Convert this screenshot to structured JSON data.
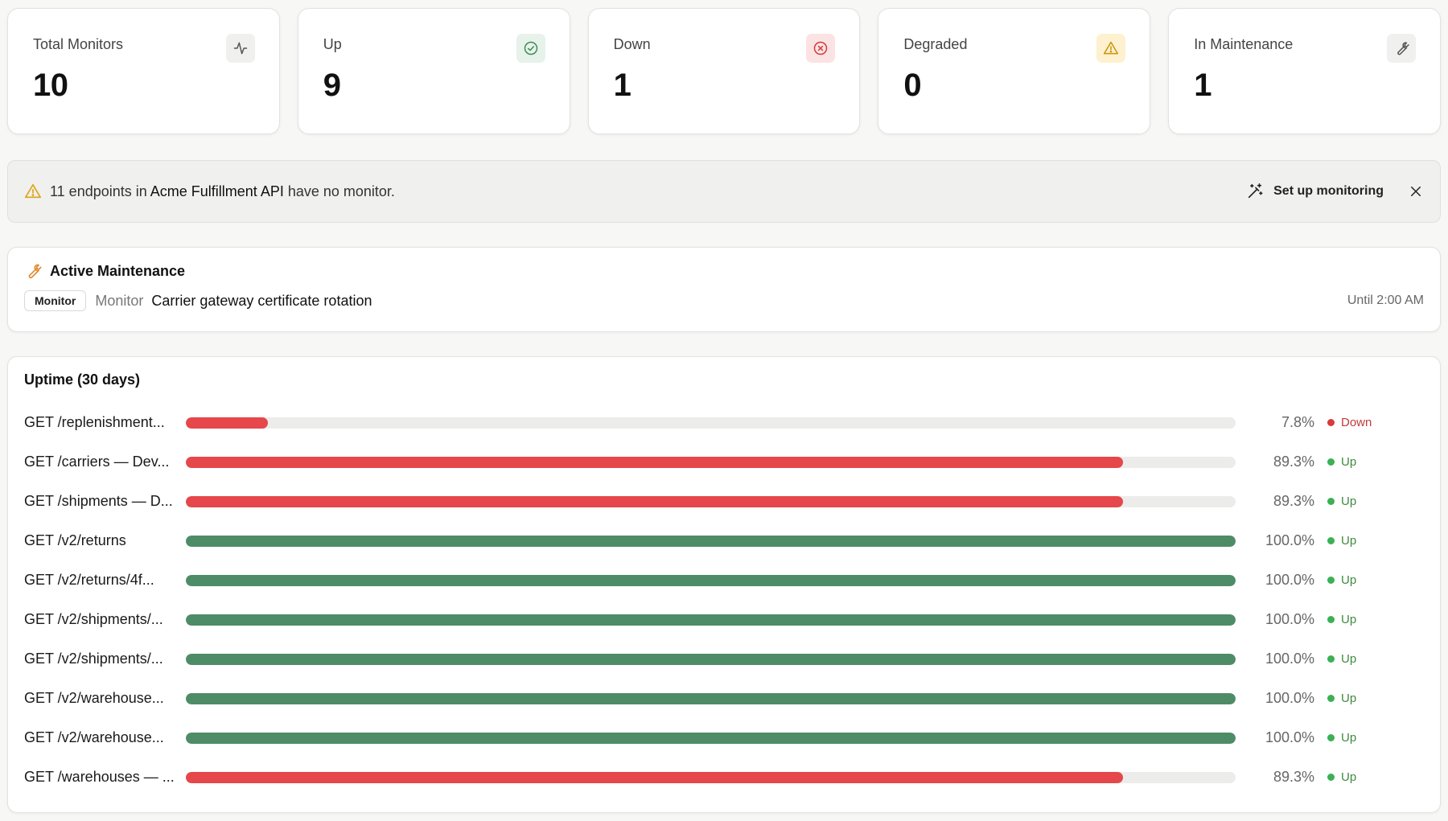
{
  "stats": [
    {
      "label": "Total Monitors",
      "value": "10",
      "icon": "activity-icon",
      "icon_bg": "#f0f0ef",
      "icon_color": "#555555"
    },
    {
      "label": "Up",
      "value": "9",
      "icon": "check-circle-icon",
      "icon_bg": "#e6f2ea",
      "icon_color": "#3f8a5c"
    },
    {
      "label": "Down",
      "value": "1",
      "icon": "x-circle-icon",
      "icon_bg": "#fbe3e3",
      "icon_color": "#d33b3b"
    },
    {
      "label": "Degraded",
      "value": "0",
      "icon": "warning-icon",
      "icon_bg": "#fdf1cf",
      "icon_color": "#c9940a"
    },
    {
      "label": "In Maintenance",
      "value": "1",
      "icon": "wrench-icon",
      "icon_bg": "#f0f0ef",
      "icon_color": "#555555"
    }
  ],
  "banner": {
    "count_text": "11 endpoints in ",
    "api_name": "Acme Fulfillment API",
    "suffix": " have no monitor.",
    "setup_label": "Set up monitoring"
  },
  "maintenance": {
    "heading": "Active Maintenance",
    "chip": "Monitor",
    "type": "Monitor",
    "title": "Carrier gateway certificate rotation",
    "until": "Until 2:00 AM"
  },
  "uptime": {
    "title": "Uptime (30 days)",
    "colors": {
      "red": "#e5474b",
      "green": "#4e8c68",
      "up_text": "#3f8a3f",
      "down_text": "#c33a3a",
      "up_dot": "#3cb054",
      "down_dot": "#d93a3a"
    },
    "rows": [
      {
        "label": "GET /replenishment...",
        "pct": "7.8%",
        "value": 7.8,
        "bar": "red",
        "status": "Down"
      },
      {
        "label": "GET /carriers — Dev...",
        "pct": "89.3%",
        "value": 89.3,
        "bar": "red",
        "status": "Up"
      },
      {
        "label": "GET /shipments — D...",
        "pct": "89.3%",
        "value": 89.3,
        "bar": "red",
        "status": "Up"
      },
      {
        "label": "GET /v2/returns",
        "pct": "100.0%",
        "value": 100,
        "bar": "green",
        "status": "Up"
      },
      {
        "label": "GET /v2/returns/4f...",
        "pct": "100.0%",
        "value": 100,
        "bar": "green",
        "status": "Up"
      },
      {
        "label": "GET /v2/shipments/...",
        "pct": "100.0%",
        "value": 100,
        "bar": "green",
        "status": "Up"
      },
      {
        "label": "GET /v2/shipments/...",
        "pct": "100.0%",
        "value": 100,
        "bar": "green",
        "status": "Up"
      },
      {
        "label": "GET /v2/warehouse...",
        "pct": "100.0%",
        "value": 100,
        "bar": "green",
        "status": "Up"
      },
      {
        "label": "GET /v2/warehouse...",
        "pct": "100.0%",
        "value": 100,
        "bar": "green",
        "status": "Up"
      },
      {
        "label": "GET /warehouses — ...",
        "pct": "89.3%",
        "value": 89.3,
        "bar": "red",
        "status": "Up"
      }
    ]
  }
}
